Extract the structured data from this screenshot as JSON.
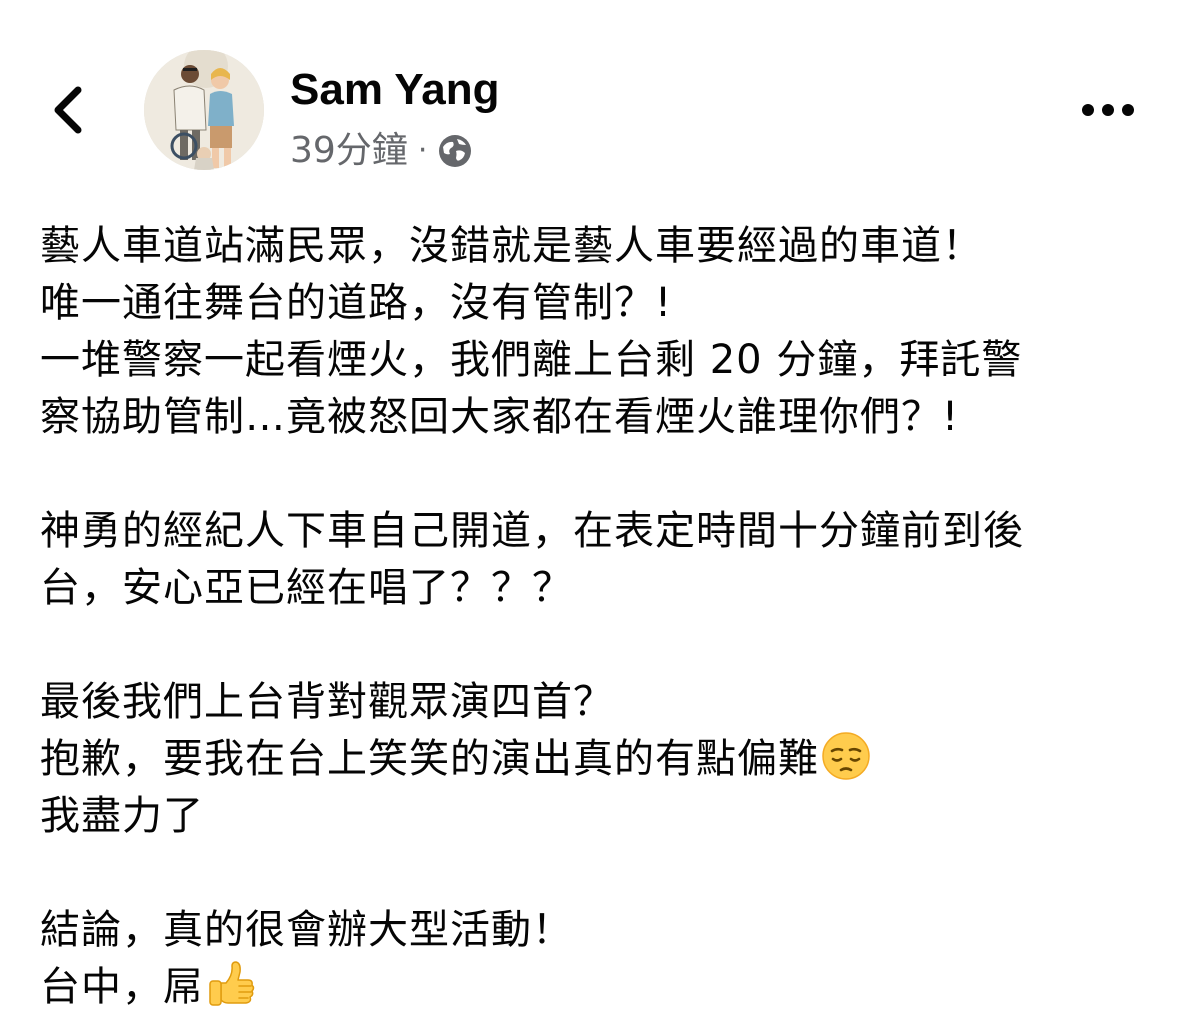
{
  "header": {
    "back_icon": "chevron-left-icon",
    "author_name": "Sam Yang",
    "timestamp": "39分鐘",
    "separator": "·",
    "privacy_icon": "globe-icon",
    "more_icon": "more-horizontal-icon"
  },
  "post": {
    "paragraphs": [
      [
        "藝人車道站滿民眾，沒錯就是藝人車要經過的車道！",
        "唯一通往舞台的道路，沒有管制？!",
        "一堆警察一起看煙火，我們離上台剩 20 分鐘，拜託警",
        "察協助管制…竟被怒回大家都在看煙火誰理你們？!"
      ],
      [
        "神勇的經紀人下車自己開道，在表定時間十分鐘前到後",
        "台，安心亞已經在唱了？？？"
      ],
      [
        "最後我們上台背對觀眾演四首？",
        "抱歉，要我在台上笑笑的演出真的有點偏難",
        "我盡力了"
      ],
      [
        "結論，真的很會辦大型活動！",
        "台中，屌"
      ]
    ],
    "emojis": {
      "pensive": "pensive-face-emoji",
      "thumbs_up": "thumbs-up-emoji"
    }
  },
  "colors": {
    "text": "#050505",
    "secondary_text": "#65676b",
    "background": "#ffffff",
    "emoji_yellow": "#ffcc4d"
  }
}
